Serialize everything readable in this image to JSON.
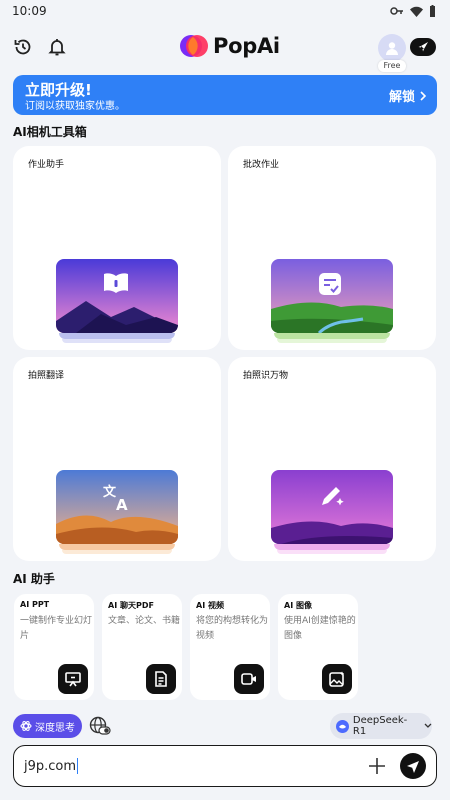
{
  "status_bar": {
    "time": "10:09"
  },
  "header": {
    "app_name": "PopAi",
    "plan_badge": "Free",
    "icons": [
      "history-icon",
      "bell-icon",
      "rocket-icon"
    ]
  },
  "banner": {
    "title": "立即升级!",
    "subtitle": "订阅以获取独家优惠。",
    "cta": "解锁"
  },
  "camera_tools": {
    "title": "AI相机工具箱",
    "items": [
      {
        "label": "作业助手",
        "icon": "book-icon",
        "theme": "purple-mountain"
      },
      {
        "label": "批改作业",
        "icon": "grade-check-icon",
        "theme": "green-valley"
      },
      {
        "label": "拍照翻译",
        "icon": "translate-icon",
        "theme": "orange-dunes"
      },
      {
        "label": "拍照识万物",
        "icon": "edit-pen-icon",
        "theme": "violet-dunes"
      }
    ]
  },
  "assistants": {
    "title": "AI 助手",
    "items": [
      {
        "title": "AI PPT",
        "desc": "一键制作专业幻灯片",
        "icon": "presentation-icon"
      },
      {
        "title": "AI 聊天PDF",
        "desc": "文章、论文、书籍",
        "icon": "document-icon"
      },
      {
        "title": "AI 视频",
        "desc": "将您的构想转化为视频",
        "icon": "video-icon"
      },
      {
        "title": "AI 图像",
        "desc": "使用AI创建惊艳的图像",
        "icon": "image-icon"
      }
    ]
  },
  "composer": {
    "deep_think_label": "深度思考",
    "model_label": "DeepSeek-R1",
    "input_value": "j9p.com"
  },
  "colors": {
    "accent_blue": "#2f80f6",
    "deep_think_purple": "#5b4ee8"
  }
}
